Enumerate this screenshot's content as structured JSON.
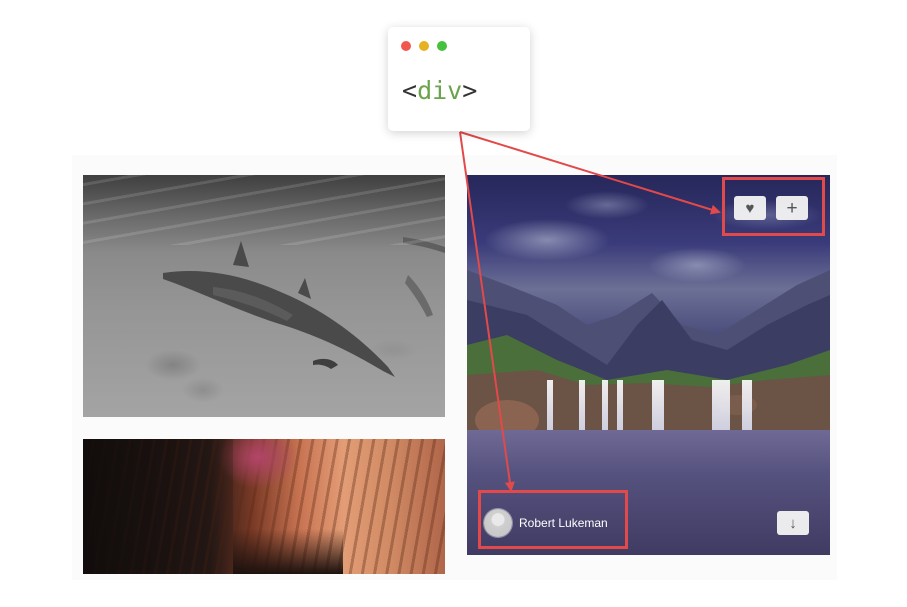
{
  "code_window": {
    "open_bracket": "<",
    "tag": "div",
    "close_bracket": ">"
  },
  "photos": [
    {
      "subject": "dolphins",
      "tone": "grayscale"
    },
    {
      "subject": "canyon"
    },
    {
      "subject": "mountain-waterfall"
    }
  ],
  "overlay": {
    "like_icon": "heart-icon",
    "like_glyph": "♥",
    "collect_icon": "plus-icon",
    "collect_glyph": "+",
    "download_icon": "download-arrow-icon",
    "download_glyph": "↓",
    "author_name": "Robert Lukeman"
  },
  "colors": {
    "highlight": "#e2494a",
    "code_tag": "#6ca34d",
    "dot_red": "#f1574f",
    "dot_yellow": "#e6b221",
    "dot_green": "#46c13e"
  }
}
